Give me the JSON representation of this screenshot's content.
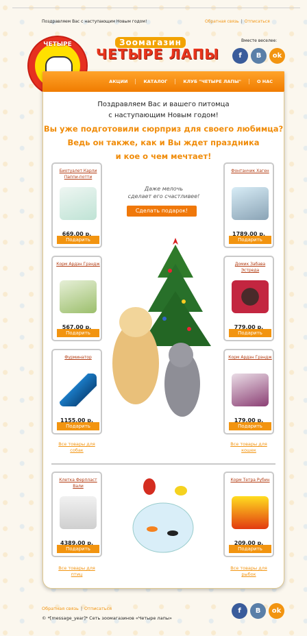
{
  "header": {
    "greeting": "Поздравляем Вас с наступающим Новым годом!",
    "feedback_link": "Обратная связь",
    "separator": "|",
    "unsubscribe_link": "Отписаться",
    "logo_top": "ЧЕТЫРЕ",
    "logo_bottom": "ЛАПЫ",
    "brand_small": "Зоомагазин",
    "brand_large": "ЧЕТЫРЕ ЛАПЫ",
    "social_label": "Вместе веселее:"
  },
  "social": [
    {
      "icon": "facebook-paw-icon",
      "letter": "f",
      "color": "#3a5c9b"
    },
    {
      "icon": "vk-paw-icon",
      "letter": "B",
      "color": "#5a7fa8"
    },
    {
      "icon": "odnoklassniki-paw-icon",
      "letter": "ok",
      "color": "#f29410"
    }
  ],
  "nav": [
    "АКЦИИ",
    "КАТАЛОГ",
    "КЛУБ \"ЧЕТЫРЕ ЛАПЫ\"",
    "О НАС"
  ],
  "intro": {
    "line1": "Поздравляем Вас и вашего питомца",
    "line2": "с наступающим Новым годом!",
    "line3": "Вы уже подготовили сюрприз для своего любимца?",
    "line4": "Ведь он также, как и Вы ждет праздника",
    "line5": "и кое о чем мечтает!"
  },
  "middle": {
    "text1": "Даже мелочь",
    "text2": "сделает его счастливее!",
    "gift_button": "Сделать подарок!"
  },
  "buy_label": "Подарить",
  "products": [
    {
      "name": "Биотуалет Карли Паппи-потти",
      "price": "669.00 р."
    },
    {
      "name": "Фонтанчик Хаген",
      "price": "1789.00 р."
    },
    {
      "name": "Корм Ардэн Грэндж",
      "price": "567.00 р."
    },
    {
      "name": "Домик Забава Эстреда",
      "price": "779.00 р."
    },
    {
      "name": "Фурминатор",
      "price": "1155.00 р."
    },
    {
      "name": "Корм Ардэн Грэндж",
      "price": "179.00 р."
    },
    {
      "name": "Клетка Ферпласт Вали",
      "price": "4389.00 р."
    },
    {
      "name": "Корм Тетра Рубин",
      "price": "209.00 р."
    }
  ],
  "all_links": {
    "dogs": "Все товары для собак",
    "cats": "Все товары для кошек",
    "birds": "Все товары для птиц",
    "fish": "Все товары для рыбок"
  },
  "footer": {
    "feedback_link": "Обратная связь",
    "separator": "|",
    "unsubscribe_link": "Отписаться",
    "copyright": "© *[message_year]* Сеть зоомагазинов «Четыре лапы»"
  }
}
